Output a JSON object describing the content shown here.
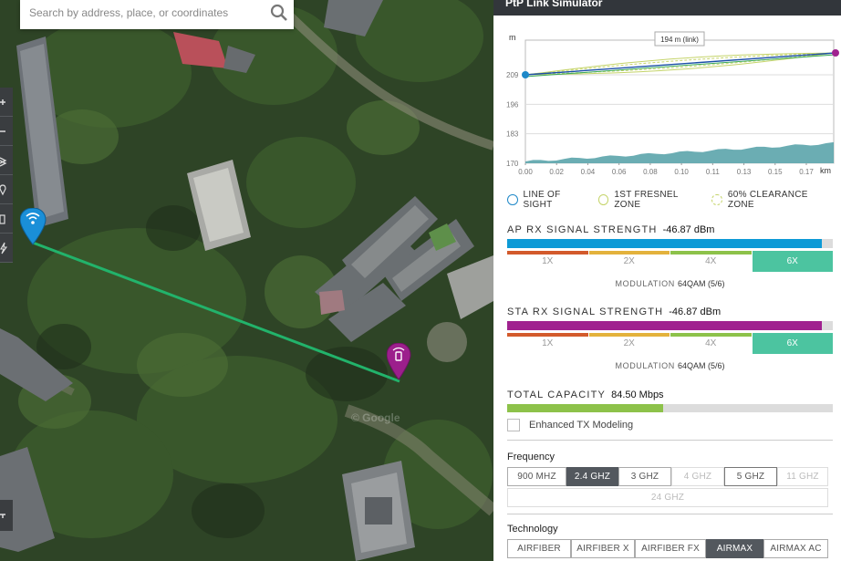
{
  "search": {
    "placeholder": "Search by address, place, or coordinates"
  },
  "map": {
    "attribution": "© Google"
  },
  "panel": {
    "title": "PtP Link Simulator",
    "profile": {
      "unit_y": "m",
      "unit_x": "km",
      "link_label": "194 m (link)",
      "y_ticks": [
        "209",
        "196",
        "183",
        "170"
      ],
      "x_ticks": [
        "0.00",
        "0.02",
        "0.04",
        "0.06",
        "0.08",
        "0.10",
        "0.11",
        "0.13",
        "0.15",
        "0.17"
      ],
      "colors": {
        "line_of_sight": "#1e88c8",
        "fresnel": "#c5d46a",
        "terrain": "#5ba4ab",
        "ap": "#1e88c8",
        "sta": "#a0228f"
      }
    },
    "legend": [
      {
        "label": "LINE OF SIGHT",
        "color": "#1e88c8"
      },
      {
        "label": "1ST FRESNEL ZONE",
        "color": "#c5d46a"
      },
      {
        "label": "60% CLEARANCE ZONE",
        "color": "#c5d46a"
      }
    ],
    "ap": {
      "title": "AP RX SIGNAL STRENGTH",
      "value": "-46.87 dBm",
      "fill_fraction": 0.966,
      "color": "#0d9ad6",
      "multipliers": [
        "1X",
        "2X",
        "4X",
        "6X"
      ],
      "modulation_label": "MODULATION",
      "modulation_value": "64QAM (5/6)"
    },
    "sta": {
      "title": "STA RX SIGNAL STRENGTH",
      "value": "-46.87 dBm",
      "fill_fraction": 0.966,
      "color": "#a0228f",
      "multipliers": [
        "1X",
        "2X",
        "4X",
        "6X"
      ],
      "modulation_label": "MODULATION",
      "modulation_value": "64QAM (5/6)"
    },
    "capacity": {
      "title": "TOTAL CAPACITY",
      "value": "84.50 Mbps",
      "fill_fraction": 0.48
    },
    "enhanced_tx": {
      "label": "Enhanced TX Modeling",
      "checked": false
    },
    "frequency": {
      "label": "Frequency",
      "options": [
        "900 MHZ",
        "2.4 GHZ",
        "3 GHZ",
        "4 GHZ",
        "5 GHZ",
        "11 GHZ"
      ],
      "extra": "24 GHZ",
      "selected": "2.4 GHZ"
    },
    "technology": {
      "label": "Technology",
      "options": [
        "AIRFIBER",
        "AIRFIBER X",
        "AIRFIBER FX",
        "AIRMAX",
        "AIRMAX AC"
      ],
      "selected": "AIRMAX"
    },
    "mult_colors": [
      "#d35a2c",
      "#e3b23c",
      "#8dc24a",
      "#4cc4a0"
    ]
  }
}
